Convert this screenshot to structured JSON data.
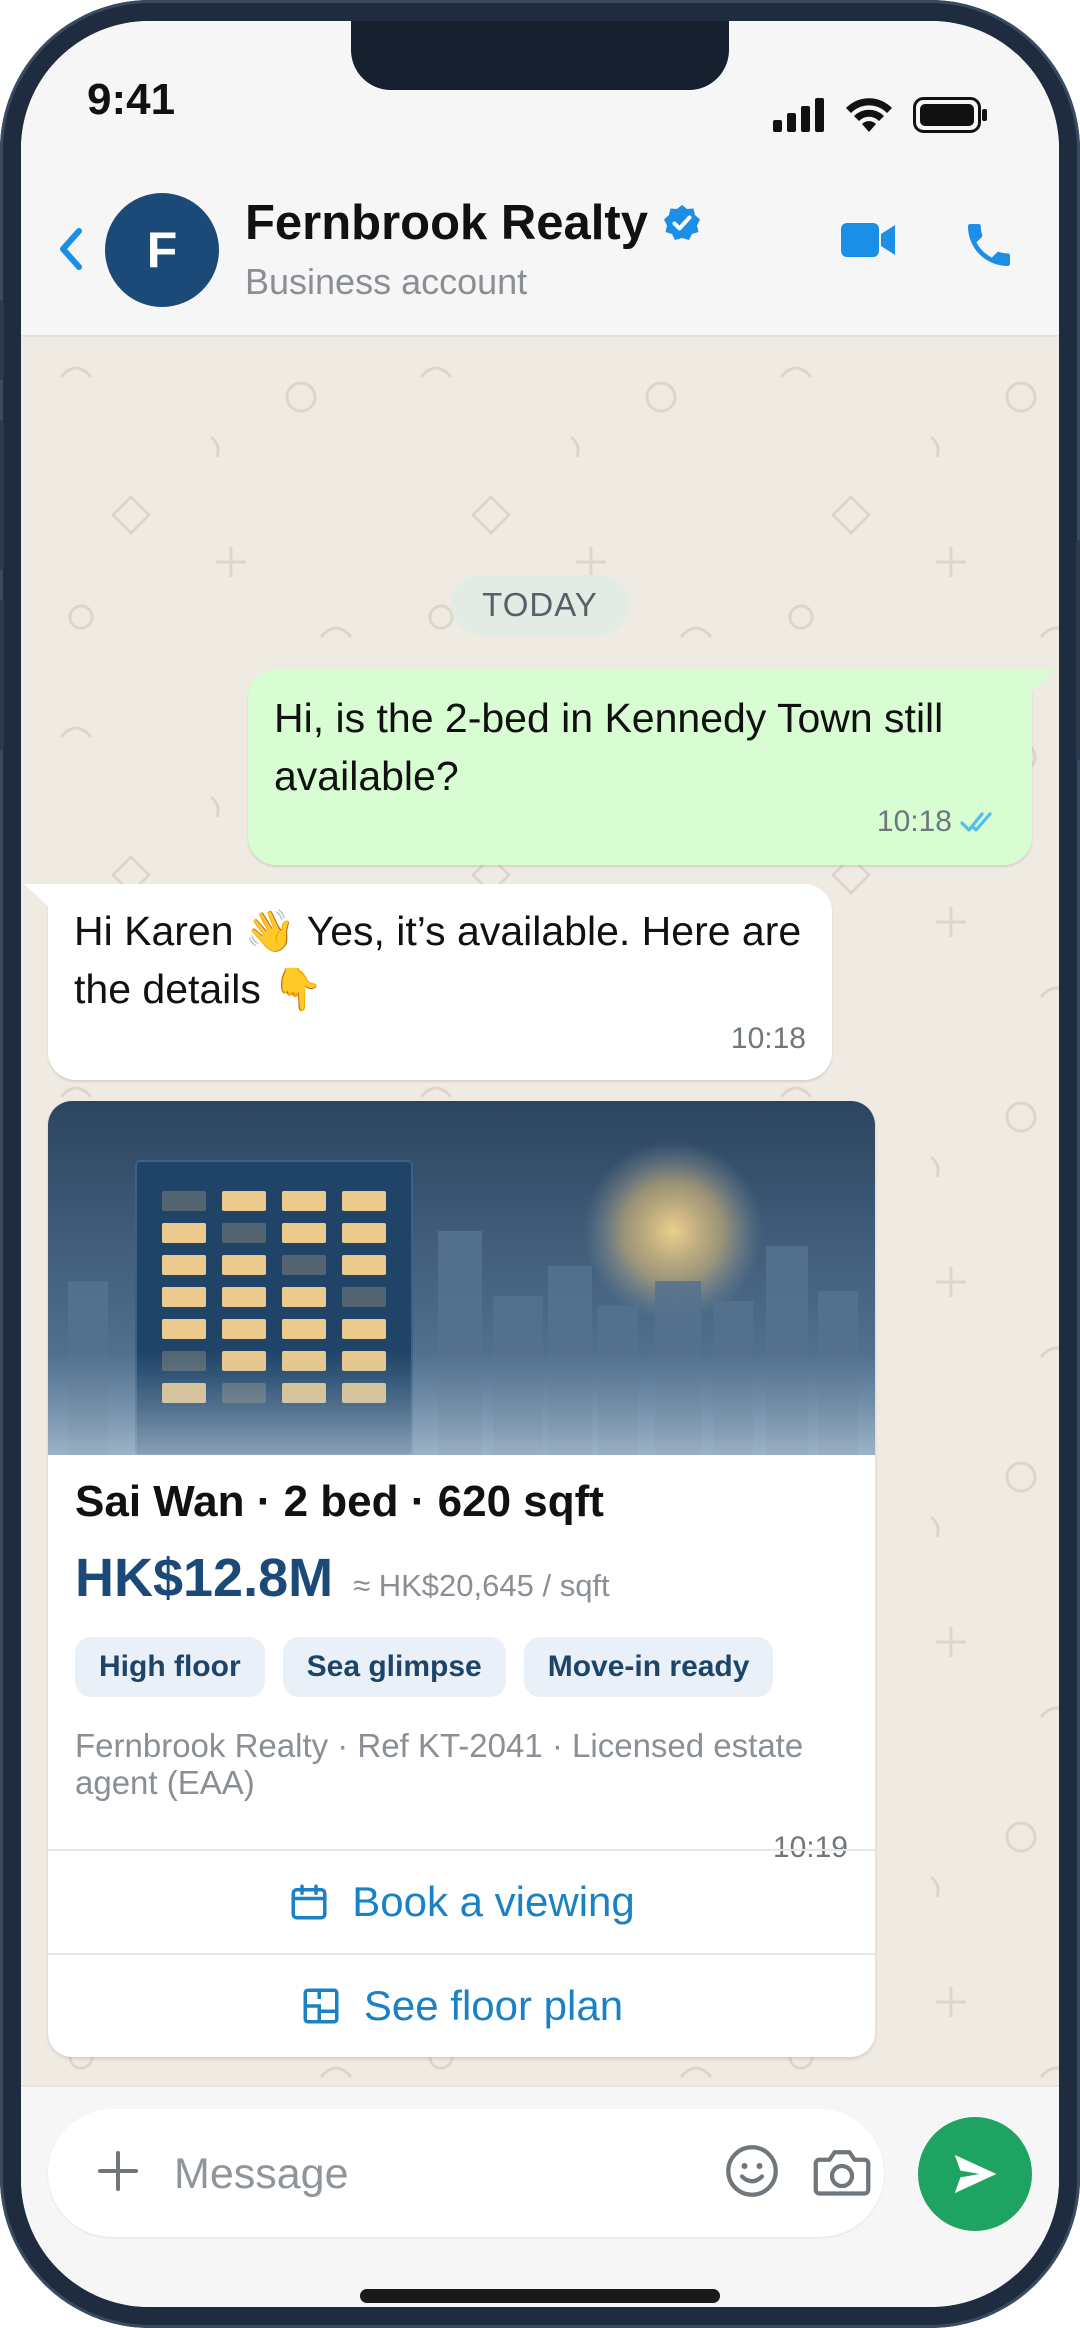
{
  "status": {
    "time": "9:41"
  },
  "header": {
    "avatar_initial": "F",
    "name": "Fernbrook Realty",
    "subtitle": "Business account"
  },
  "chat": {
    "date_divider": "TODAY",
    "messages": [
      {
        "direction": "outgoing",
        "text": "Hi, is the 2-bed in Kennedy Town still available?",
        "time": "10:18",
        "read": true
      },
      {
        "direction": "incoming",
        "text": "Hi Karen 👋 Yes, it’s available. Here are the details 👇",
        "time": "10:18"
      }
    ],
    "listing_card": {
      "title": "Sai Wan · 2 bed · 620 sqft",
      "price": "HK$12.8M",
      "price_per_sqft": "≈ HK$20,645 / sqft",
      "tags": [
        "High floor",
        "Sea glimpse",
        "Move-in ready"
      ],
      "agent_line": "Fernbrook Realty · Ref KT-2041 · Licensed estate agent (EAA)",
      "time": "10:19",
      "actions": [
        {
          "label": "Book a viewing",
          "icon": "calendar-icon"
        },
        {
          "label": "See floor plan",
          "icon": "floor-plan-icon"
        }
      ]
    }
  },
  "composer": {
    "placeholder": "Message"
  },
  "colors": {
    "outgoing_bubble": "#d9fdd3",
    "incoming_bubble": "#ffffff",
    "accent_blue": "#1a82c4",
    "brand_navy": "#1c4a78",
    "send_green": "#1ea362",
    "verified_blue": "#1b8ee6"
  }
}
